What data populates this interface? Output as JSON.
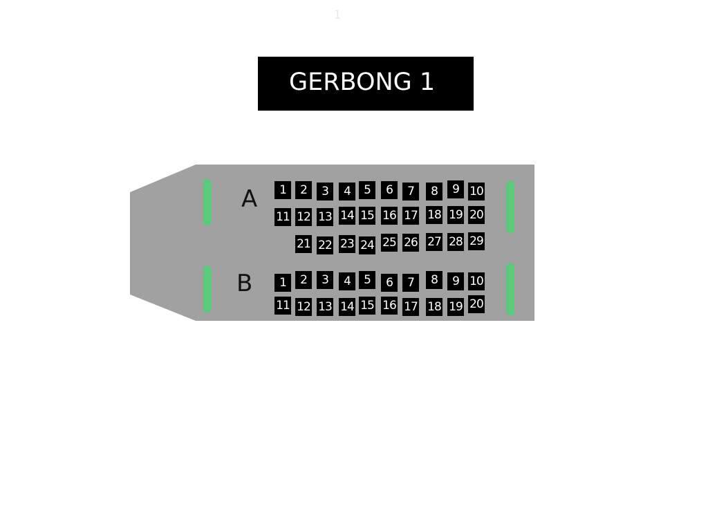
{
  "page_number": "1",
  "title": "GERBONG 1",
  "colors": {
    "car_body": "#a1a1a1",
    "door": "#5ac97a",
    "seat": "#000000",
    "seat_text": "#ffffff"
  },
  "rows": {
    "A": {
      "label": "A",
      "seats": [
        "1",
        "2",
        "3",
        "4",
        "5",
        "6",
        "7",
        "8",
        "9",
        "10",
        "11",
        "12",
        "13",
        "14",
        "15",
        "16",
        "17",
        "18",
        "19",
        "20",
        "21",
        "22",
        "23",
        "24",
        "25",
        "26",
        "27",
        "28",
        "29"
      ]
    },
    "B": {
      "label": "B",
      "seats": [
        "1",
        "2",
        "3",
        "4",
        "5",
        "6",
        "7",
        "8",
        "9",
        "10",
        "11",
        "12",
        "13",
        "14",
        "15",
        "16",
        "17",
        "18",
        "19",
        "20"
      ]
    }
  }
}
